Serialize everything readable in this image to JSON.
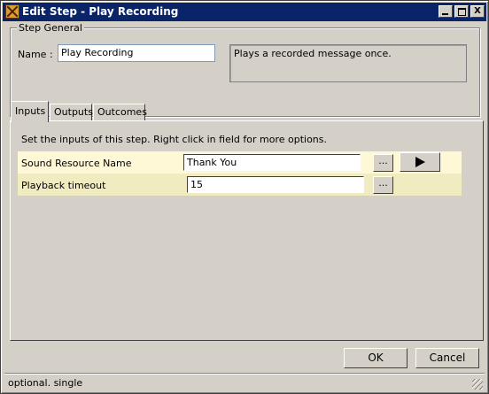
{
  "window": {
    "title": "Edit Step - Play Recording",
    "icons": {
      "app": "wrench-icon",
      "minimize": "minimize-icon",
      "maximize": "maximize-icon",
      "close": "close-icon"
    },
    "close_glyph": "X"
  },
  "step_general": {
    "legend": "Step General",
    "name_label": "Name :",
    "name_value": "Play Recording",
    "description": "Plays a recorded message once."
  },
  "tabs": [
    {
      "label": "Inputs",
      "active": true
    },
    {
      "label": "Outputs",
      "active": false
    },
    {
      "label": "Outcomes",
      "active": false
    }
  ],
  "inputs": {
    "hint": "Set the inputs of this step.  Right click in field for more options.",
    "rows": [
      {
        "label": "Sound Resource Name",
        "value": "Thank You",
        "browse": "..."
      },
      {
        "label": "Playback timeout",
        "value": "15",
        "browse": "..."
      }
    ],
    "play_icon": "play-icon"
  },
  "buttons": {
    "ok": "OK",
    "cancel": "Cancel"
  },
  "status": {
    "text": "optional. single"
  },
  "colors": {
    "titlebar": "#0a246a",
    "row_odd": "#fff8d6",
    "row_even": "#f1ebc2",
    "face": "#d4d0c8"
  }
}
